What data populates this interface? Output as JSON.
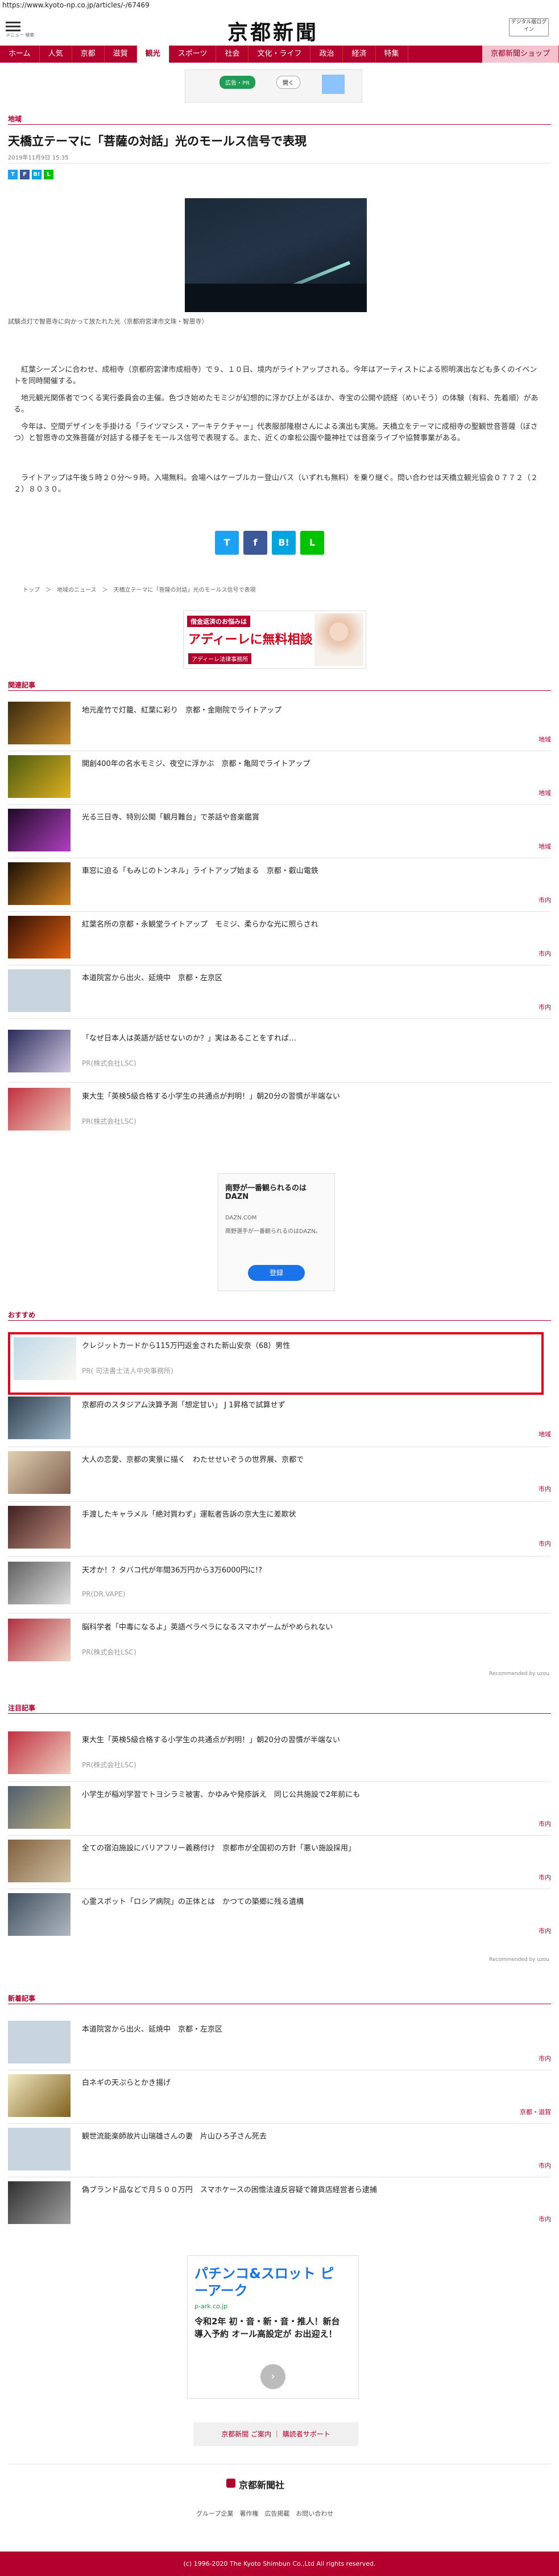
{
  "url": "https://www.kyoto-np.co.jp/articles/-/67469",
  "header": {
    "menu_label": "メニュー 検索",
    "logo": "京都新聞",
    "digital_button": "デジタル版ログイン"
  },
  "nav": {
    "items": [
      "ホーム",
      "人気",
      "京都",
      "滋賀",
      "観光",
      "スポーツ",
      "社会",
      "文化・ライフ",
      "政治",
      "経済",
      "特集"
    ],
    "active_index": 4,
    "shop": "京都新聞ショップ"
  },
  "ad_top": {
    "button1": "広告・PR",
    "button2": "開く"
  },
  "article": {
    "category": "地域",
    "title": "天橋立テーマに「菩薩の対話」光のモールス信号で表現",
    "date": "2019年11月9日 15:35",
    "caption": "試験点灯で智恩寺に向かって放たれた光（京都府宮津市文珠・智恩寺）",
    "paragraphs": [
      "紅葉シーズンに合わせ、成相寺（京都府宮津市成相寺）で９、１０日、境内がライトアップされる。今年はアーティストによる照明演出なども多くのイベントを同時開催する。",
      "地元観光関係者でつくる実行委員会の主催。色づき始めたモミジが幻想的に浮かび上がるほか、寺宝の公開や読経（めいそう）の体験（有料、先着順）がある。",
      "今年は、空間デザインを手掛ける「ライツマシス・アーキテクチャー」代表服部隆樹さんによる演出も実施。天橋立をテーマに成相寺の聖観世音菩薩（ぼさつ）と智恩寺の文殊菩薩が対話する様子をモールス信号で表現する。また、近くの傘松公園や籠神社では音楽ライブや協賛事業がある。",
      "ライトアップは午後５時２０分〜９時。入場無料。会場へはケーブルカー登山バス（いずれも無料）を乗り継ぐ。問い合わせは天橋立観光協会０７７２（２２）８０３０。"
    ],
    "share_small": [
      "T",
      "F",
      "B!",
      "L"
    ],
    "share_large": [
      "T",
      "f",
      "B!",
      "L"
    ],
    "breadcrumb": "トップ　＞　地域のニュース　＞　天橋立テーマに「菩薩の対話」光のモールス信号で表現"
  },
  "ad_middle": {
    "badge": "借金返済のお悩みは",
    "big": "アディーレに無料相談",
    "sub": "アディーレ法律事務所"
  },
  "related": {
    "label": "関連記事",
    "items": [
      {
        "title": "地元産竹で灯籠、紅葉に彩り　京都・金剛院でライトアップ",
        "cat": "地域"
      },
      {
        "title": "開創400年の名水モミジ、夜空に浮かぶ　京都・亀岡でライトアップ",
        "cat": "地域"
      },
      {
        "title": "光る三日寺、特別公開「観月難台」で茶話や音楽鑑賞",
        "cat": "地域"
      },
      {
        "title": "車窓に迫る「もみじのトンネル」ライトアップ始まる　京都・叡山電鉄",
        "cat": "市内"
      },
      {
        "title": "紅葉名所の京都・永観堂ライトアップ　モミジ、柔らかな光に照らされ",
        "cat": "市内"
      },
      {
        "title": "本道院宮から出火、延焼中　京都・左京区",
        "cat": "市内"
      },
      {
        "title": "「なぜ日本人は英語が話せないのか？」実はあることをすれば…",
        "cat": "",
        "sub": "PR(株式会社LSC)"
      },
      {
        "title": "東大生「英検5級合格する小学生の共通点が判明！」朝20分の習慣が半端ない",
        "cat": "",
        "sub": "PR(株式会社LSC)"
      }
    ]
  },
  "ad_google": {
    "head": "南野が一番観られるのはDAZN",
    "domain": "DAZN.COM",
    "text": "南野選手が一番観られるのはDAZN。",
    "cta": "登録"
  },
  "osusume": {
    "label": "おすすめ",
    "items": [
      {
        "title": "クレジットカードから115万円返金された新山安奈（68）男性",
        "sub": "PR( 司法書士法人中央事務所)",
        "cat": ""
      },
      {
        "title": "京都府のスタジアム決算予測「想定甘い」 J 1昇格で試算せず",
        "sub": "",
        "cat": "地域"
      },
      {
        "title": "大人の恋愛、京都の実景に描く　わたせせいぞうの世界展、京都で",
        "sub": "",
        "cat": "市内"
      },
      {
        "title": "手渡したキャラメル「絶対買わず」運転者告訴の京大生に差欺状",
        "sub": "",
        "cat": "市内"
      },
      {
        "title": "天才か！？タバコ代が年間36万円から3万6000円に!?",
        "sub": "PR(DR.VAPE)",
        "cat": ""
      },
      {
        "title": "脳科学者「中毒になるよ」英語ペラペラになるスマホゲームがやめられない",
        "sub": "PR(株式会社LSC)",
        "cat": ""
      }
    ],
    "recommended": "Recommended by uzou"
  },
  "chumoku": {
    "label": "注目記事",
    "items": [
      {
        "title": "東大生「英検5級合格する小学生の共通点が判明！」朝20分の習慣が半端ない",
        "sub": "PR(株式会社LSC)",
        "cat": ""
      },
      {
        "title": "小学生が稲刈学習でトヨシラミ被害、かゆみや発疹訴え　同じ公共施設で2年前にも",
        "sub": "",
        "cat": "市内"
      },
      {
        "title": "全ての宿泊施設にバリアフリー義務付け　京都市が全国初の方針「悪い施設採用」",
        "sub": "",
        "cat": "市内"
      },
      {
        "title": "心霊スポット「ロシア病院」の正体とは　かつての築郷に残る遺構",
        "sub": "",
        "cat": "市内"
      }
    ],
    "recommended": "Recommended by uzou"
  },
  "shinchaku": {
    "label": "新着記事",
    "items": [
      {
        "title": "本道院宮から出火、延焼中　京都・左京区",
        "cat": "市内"
      },
      {
        "title": "白ネギの天ぷらとかき揚げ",
        "cat": "京都・滋賀"
      },
      {
        "title": "観世流能楽師故片山瑞雄さんの妻　片山ひろ子さん死去",
        "cat": "市内"
      },
      {
        "title": "偽ブランド品などで月５００万円　スマホケースの困憺法違反容疑で雑貨店経営者ら逮捕",
        "cat": "市内"
      }
    ]
  },
  "ad_pachinko": {
    "title": "パチンコ&スロット ピーアーク",
    "domain": "p-ark.co.jp",
    "text": "令和2年 初・音・新・音・推人！新台導入予約 オール高設定が お出迎え！"
  },
  "footer": {
    "links": "京都新聞 ご案内 ｜ 購読者サポート",
    "logo": "京都新聞社",
    "nav": "グループ企業　著作権　広告掲載　お問い合わせ",
    "copyright": "(c) 1996-2020 The Kyoto Shimbun Co.,Ltd All rights reserved."
  }
}
